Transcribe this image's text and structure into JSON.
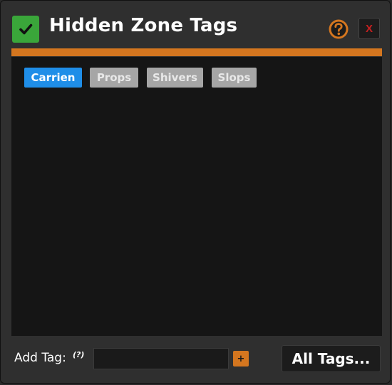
{
  "window": {
    "title": "Hidden Zone Tags",
    "enabled_icon": "checkmark-icon",
    "help_icon": "help-icon",
    "close_label": "X"
  },
  "tags": [
    {
      "label": "Carrien",
      "active": true
    },
    {
      "label": "Props",
      "active": false
    },
    {
      "label": "Shivers",
      "active": false
    },
    {
      "label": "Slops",
      "active": false
    }
  ],
  "footer": {
    "add_tag_label": "Add Tag:",
    "add_tag_hint": "(?)",
    "input_value": "",
    "add_button_label": "+",
    "all_tags_label": "All Tags..."
  },
  "colors": {
    "accent_orange": "#d4761f",
    "active_tag": "#1f8ee8",
    "inactive_tag": "#a6a6a6",
    "check_green": "#3aa63a",
    "close_red": "#c62020"
  }
}
